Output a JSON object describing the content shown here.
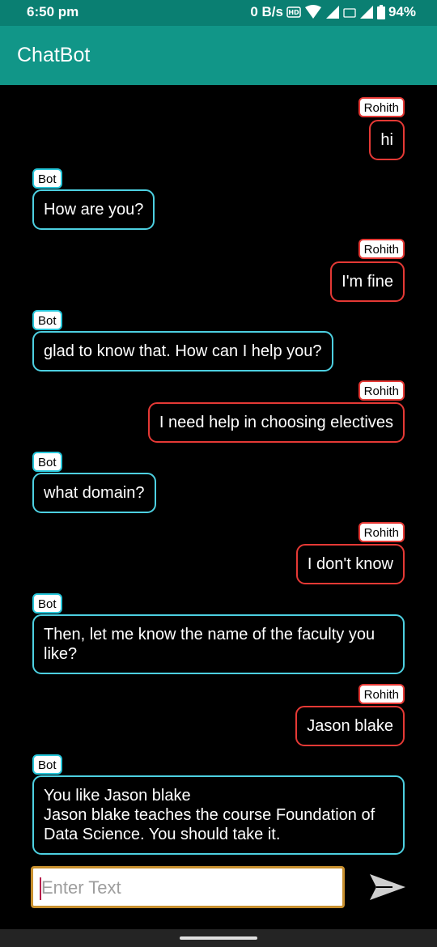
{
  "status_bar": {
    "time": "6:50 pm",
    "net_speed": "0 B/s",
    "battery": "94%"
  },
  "app": {
    "title": "ChatBot"
  },
  "messages": [
    {
      "sender": "Rohith",
      "role": "user",
      "text": "hi"
    },
    {
      "sender": "Bot",
      "role": "bot",
      "text": "How are you?"
    },
    {
      "sender": "Rohith",
      "role": "user",
      "text": "I'm fine"
    },
    {
      "sender": "Bot",
      "role": "bot",
      "text": "glad to know that. How can I help you?"
    },
    {
      "sender": "Rohith",
      "role": "user",
      "text": "I need help in choosing electives"
    },
    {
      "sender": "Bot",
      "role": "bot",
      "text": "what domain?"
    },
    {
      "sender": "Rohith",
      "role": "user",
      "text": "I don't know"
    },
    {
      "sender": "Bot",
      "role": "bot",
      "text": "Then, let me know the name of the faculty you like?"
    },
    {
      "sender": "Rohith",
      "role": "user",
      "text": "Jason blake"
    },
    {
      "sender": "Bot",
      "role": "bot",
      "text": "You like Jason blake\nJason blake teaches the course Foundation of Data Science. You should take it."
    }
  ],
  "composer": {
    "placeholder": "Enter Text",
    "value": ""
  },
  "colors": {
    "app_bar": "#119688",
    "status_bar": "#0a7f72",
    "user_border": "#e53935",
    "bot_border": "#4dd0e1",
    "input_border": "#c8902f"
  },
  "icons": {
    "send": "send-icon"
  }
}
